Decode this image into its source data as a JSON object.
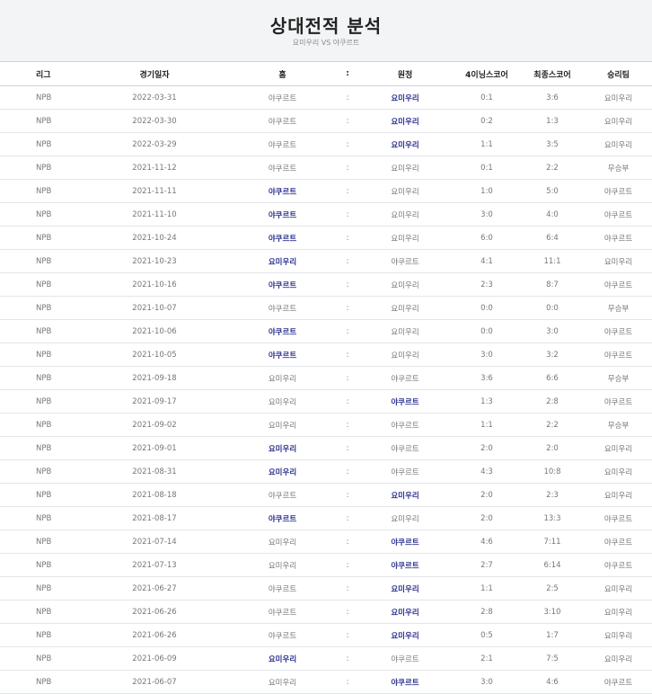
{
  "header": {
    "title": "상대전적 분석",
    "subtitle": "요미우리 VS 야쿠르트"
  },
  "columns": [
    "리그",
    "경기일자",
    "홈",
    ":",
    "원정",
    "4이닝스코어",
    "최종스코어",
    "승리팀"
  ],
  "rows": [
    {
      "league": "NPB",
      "date": "2022-03-31",
      "home": "야쿠르트",
      "sep": ":",
      "away": "요미우리",
      "score4": "0:1",
      "final": "3:6",
      "winner": "요미우리",
      "win_side": "away"
    },
    {
      "league": "NPB",
      "date": "2022-03-30",
      "home": "야쿠르트",
      "sep": ":",
      "away": "요미우리",
      "score4": "0:2",
      "final": "1:3",
      "winner": "요미우리",
      "win_side": "away"
    },
    {
      "league": "NPB",
      "date": "2022-03-29",
      "home": "야쿠르트",
      "sep": ":",
      "away": "요미우리",
      "score4": "1:1",
      "final": "3:5",
      "winner": "요미우리",
      "win_side": "away"
    },
    {
      "league": "NPB",
      "date": "2021-11-12",
      "home": "야쿠르트",
      "sep": ":",
      "away": "요미우리",
      "score4": "0:1",
      "final": "2:2",
      "winner": "무승부",
      "win_side": "none"
    },
    {
      "league": "NPB",
      "date": "2021-11-11",
      "home": "야쿠르트",
      "sep": ":",
      "away": "요미우리",
      "score4": "1:0",
      "final": "5:0",
      "winner": "야쿠르트",
      "win_side": "home"
    },
    {
      "league": "NPB",
      "date": "2021-11-10",
      "home": "야쿠르트",
      "sep": ":",
      "away": "요미우리",
      "score4": "3:0",
      "final": "4:0",
      "winner": "야쿠르트",
      "win_side": "home"
    },
    {
      "league": "NPB",
      "date": "2021-10-24",
      "home": "야쿠르트",
      "sep": ":",
      "away": "요미우리",
      "score4": "6:0",
      "final": "6:4",
      "winner": "야쿠르트",
      "win_side": "home"
    },
    {
      "league": "NPB",
      "date": "2021-10-23",
      "home": "요미우리",
      "sep": ":",
      "away": "야쿠르트",
      "score4": "4:1",
      "final": "11:1",
      "winner": "요미우리",
      "win_side": "home"
    },
    {
      "league": "NPB",
      "date": "2021-10-16",
      "home": "야쿠르트",
      "sep": ":",
      "away": "요미우리",
      "score4": "2:3",
      "final": "8:7",
      "winner": "야쿠르트",
      "win_side": "home"
    },
    {
      "league": "NPB",
      "date": "2021-10-07",
      "home": "야쿠르트",
      "sep": ":",
      "away": "요미우리",
      "score4": "0:0",
      "final": "0:0",
      "winner": "무승부",
      "win_side": "none"
    },
    {
      "league": "NPB",
      "date": "2021-10-06",
      "home": "야쿠르트",
      "sep": ":",
      "away": "요미우리",
      "score4": "0:0",
      "final": "3:0",
      "winner": "야쿠르트",
      "win_side": "home"
    },
    {
      "league": "NPB",
      "date": "2021-10-05",
      "home": "야쿠르트",
      "sep": ":",
      "away": "요미우리",
      "score4": "3:0",
      "final": "3:2",
      "winner": "야쿠르트",
      "win_side": "home"
    },
    {
      "league": "NPB",
      "date": "2021-09-18",
      "home": "요미우리",
      "sep": ":",
      "away": "야쿠르트",
      "score4": "3:6",
      "final": "6:6",
      "winner": "무승부",
      "win_side": "none"
    },
    {
      "league": "NPB",
      "date": "2021-09-17",
      "home": "요미우리",
      "sep": ":",
      "away": "야쿠르트",
      "score4": "1:3",
      "final": "2:8",
      "winner": "야쿠르트",
      "win_side": "away"
    },
    {
      "league": "NPB",
      "date": "2021-09-02",
      "home": "요미우리",
      "sep": ":",
      "away": "야쿠르트",
      "score4": "1:1",
      "final": "2:2",
      "winner": "무승부",
      "win_side": "none"
    },
    {
      "league": "NPB",
      "date": "2021-09-01",
      "home": "요미우리",
      "sep": ":",
      "away": "야쿠르트",
      "score4": "2:0",
      "final": "2:0",
      "winner": "요미우리",
      "win_side": "home"
    },
    {
      "league": "NPB",
      "date": "2021-08-31",
      "home": "요미우리",
      "sep": ":",
      "away": "야쿠르트",
      "score4": "4:3",
      "final": "10:8",
      "winner": "요미우리",
      "win_side": "home"
    },
    {
      "league": "NPB",
      "date": "2021-08-18",
      "home": "야쿠르트",
      "sep": ":",
      "away": "요미우리",
      "score4": "2:0",
      "final": "2:3",
      "winner": "요미우리",
      "win_side": "away"
    },
    {
      "league": "NPB",
      "date": "2021-08-17",
      "home": "야쿠르트",
      "sep": ":",
      "away": "요미우리",
      "score4": "2:0",
      "final": "13:3",
      "winner": "야쿠르트",
      "win_side": "home"
    },
    {
      "league": "NPB",
      "date": "2021-07-14",
      "home": "요미우리",
      "sep": ":",
      "away": "야쿠르트",
      "score4": "4:6",
      "final": "7:11",
      "winner": "야쿠르트",
      "win_side": "away"
    },
    {
      "league": "NPB",
      "date": "2021-07-13",
      "home": "요미우리",
      "sep": ":",
      "away": "야쿠르트",
      "score4": "2:7",
      "final": "6:14",
      "winner": "야쿠르트",
      "win_side": "away"
    },
    {
      "league": "NPB",
      "date": "2021-06-27",
      "home": "야쿠르트",
      "sep": ":",
      "away": "요미우리",
      "score4": "1:1",
      "final": "2:5",
      "winner": "요미우리",
      "win_side": "away"
    },
    {
      "league": "NPB",
      "date": "2021-06-26",
      "home": "야쿠르트",
      "sep": ":",
      "away": "요미우리",
      "score4": "2:8",
      "final": "3:10",
      "winner": "요미우리",
      "win_side": "away"
    },
    {
      "league": "NPB",
      "date": "2021-06-26",
      "home": "야쿠르트",
      "sep": ":",
      "away": "요미우리",
      "score4": "0:5",
      "final": "1:7",
      "winner": "요미우리",
      "win_side": "away"
    },
    {
      "league": "NPB",
      "date": "2021-06-09",
      "home": "요미우리",
      "sep": ":",
      "away": "야쿠르트",
      "score4": "2:1",
      "final": "7:5",
      "winner": "요미우리",
      "win_side": "home"
    },
    {
      "league": "NPB",
      "date": "2021-06-07",
      "home": "요미우리",
      "sep": ":",
      "away": "야쿠르트",
      "score4": "3:0",
      "final": "4:6",
      "winner": "야쿠르트",
      "win_side": "away"
    }
  ],
  "colors": {
    "header_bg": "#f3f4f6",
    "winner_text": "#2a2f8f",
    "body_text": "#777777"
  }
}
